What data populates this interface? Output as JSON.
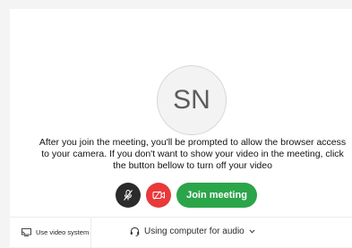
{
  "avatar": {
    "initials": "SN"
  },
  "message": {
    "line1": "After you join the meeting, you'll be prompted to allow the browser access",
    "line2": "to your camera. If you don't want to show your video in the meeting, click",
    "line3": "the button bellow to turn off your video"
  },
  "controls": {
    "mute_icon": "mic-off-icon",
    "video_icon": "video-off-icon",
    "join_label": "Join meeting"
  },
  "footer": {
    "video_system_label": "Use video system",
    "audio_label": "Using computer for audio"
  },
  "colors": {
    "join": "#2ba54a",
    "video_off": "#e8393b",
    "mute": "#2b2b2b"
  }
}
